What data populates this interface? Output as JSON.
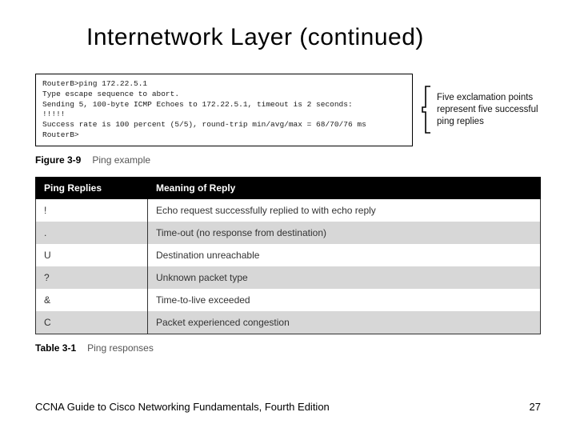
{
  "title": "Internetwork Layer (continued)",
  "terminal": {
    "l1": "RouterB>ping 172.22.5.1",
    "l2": "Type escape sequence to abort.",
    "l3": "Sending 5, 100-byte ICMP Echoes to 172.22.5.1, timeout is 2 seconds:",
    "l4": "!!!!!",
    "l5": "Success rate is 100 percent (5/5), round-trip min/avg/max = 68/70/76 ms",
    "l6": "RouterB>"
  },
  "annotation": "Five exclamation points represent five successful ping replies",
  "figure": {
    "label": "Figure 3-9",
    "desc": "Ping example"
  },
  "table_cap": {
    "label": "Table 3-1",
    "desc": "Ping responses"
  },
  "headers": {
    "c1": "Ping Replies",
    "c2": "Meaning of Reply"
  },
  "rows": [
    {
      "s": "!",
      "m": "Echo request successfully replied to with echo reply"
    },
    {
      "s": ".",
      "m": "Time-out (no response from destination)"
    },
    {
      "s": "U",
      "m": "Destination unreachable"
    },
    {
      "s": "?",
      "m": "Unknown packet type"
    },
    {
      "s": "&",
      "m": "Time-to-live exceeded"
    },
    {
      "s": "C",
      "m": "Packet experienced congestion"
    }
  ],
  "footer": {
    "text": "CCNA Guide to Cisco Networking Fundamentals, Fourth Edition",
    "page": "27"
  }
}
